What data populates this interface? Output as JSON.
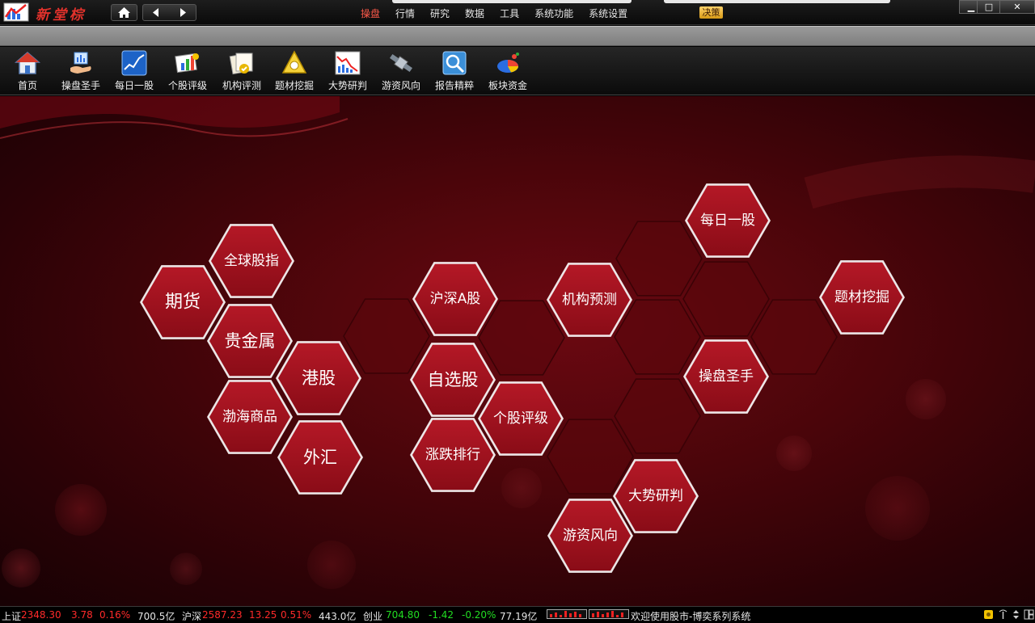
{
  "app": {
    "brand": "新堂棕"
  },
  "top_menu": [
    {
      "label": "操盘",
      "active": true
    },
    {
      "label": "行情",
      "active": false
    },
    {
      "label": "研究",
      "active": false
    },
    {
      "label": "数据",
      "active": false
    },
    {
      "label": "工具",
      "active": false
    },
    {
      "label": "系统功能",
      "active": false
    },
    {
      "label": "系统设置",
      "active": false
    }
  ],
  "juece_button": "决策",
  "window_controls": {
    "minimize": "▁",
    "maximize": "□",
    "close": "✕"
  },
  "toolbar": [
    {
      "label": "首页",
      "icon": "home-icon"
    },
    {
      "label": "操盘圣手",
      "icon": "trader-hand-icon"
    },
    {
      "label": "每日一股",
      "icon": "daily-chart-icon"
    },
    {
      "label": "个股评级",
      "icon": "stock-rating-icon"
    },
    {
      "label": "机构评测",
      "icon": "institution-eval-icon"
    },
    {
      "label": "题材挖掘",
      "icon": "theme-mining-icon"
    },
    {
      "label": "大势研判",
      "icon": "market-trend-icon"
    },
    {
      "label": "游资风向",
      "icon": "hot-money-icon"
    },
    {
      "label": "报告精粹",
      "icon": "report-icon"
    },
    {
      "label": "板块资金",
      "icon": "sector-funds-icon"
    }
  ],
  "hex_tiles": [
    {
      "label": "期货"
    },
    {
      "label": "全球股指"
    },
    {
      "label": "贵金属"
    },
    {
      "label": "港股"
    },
    {
      "label": "渤海商品"
    },
    {
      "label": "外汇"
    },
    {
      "label": "沪深A股"
    },
    {
      "label": "自选股"
    },
    {
      "label": "涨跌排行"
    },
    {
      "label": "个股评级"
    },
    {
      "label": "机构预测"
    },
    {
      "label": "每日一股"
    },
    {
      "label": "操盘圣手"
    },
    {
      "label": "题材挖掘"
    },
    {
      "label": "大势研判"
    },
    {
      "label": "游资风向"
    }
  ],
  "status": {
    "sh_label": "上证",
    "sh_value": "2348.30",
    "sh_change": "3.78",
    "sh_pct": "0.16%",
    "sh_volume": "700.5亿",
    "hs_label": "沪深",
    "hs_value": "2587.23",
    "hs_change": "13.25",
    "hs_pct": "0.51%",
    "hs_volume": "443.0亿",
    "cy_label": "创业",
    "cy_value": "704.80",
    "cy_change": "-1.42",
    "cy_pct": "-0.20%",
    "cy_volume": "77.19亿",
    "welcome": "欢迎使用股市-博奕系列系统"
  },
  "colors": {
    "up": "#ff2a2a",
    "down": "#22dd22",
    "hex_fill": "#a2121f",
    "accent_menu": "#ff5a4a"
  }
}
